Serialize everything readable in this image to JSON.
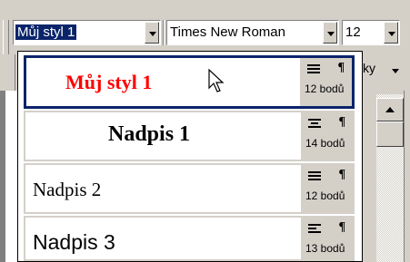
{
  "toolbar": {
    "style_value": "Můj styl 1",
    "font_value": "Times New Roman",
    "size_value": "12",
    "behind_label": "ky"
  },
  "style_list": [
    {
      "name": "Můj styl 1",
      "size_label": "12 bodů",
      "align": "justify",
      "color": "#ff0000"
    },
    {
      "name": "Nadpis 1",
      "size_label": "14 bodů",
      "align": "center",
      "color": "#000000"
    },
    {
      "name": "Nadpis 2",
      "size_label": "12 bodů",
      "align": "justify",
      "color": "#000000"
    },
    {
      "name": "Nadpis 3",
      "size_label": "13 bodů",
      "align": "left",
      "color": "#000000"
    }
  ],
  "icons": {
    "paragraph": "¶",
    "cursor": "arrow-pointer-icon"
  }
}
